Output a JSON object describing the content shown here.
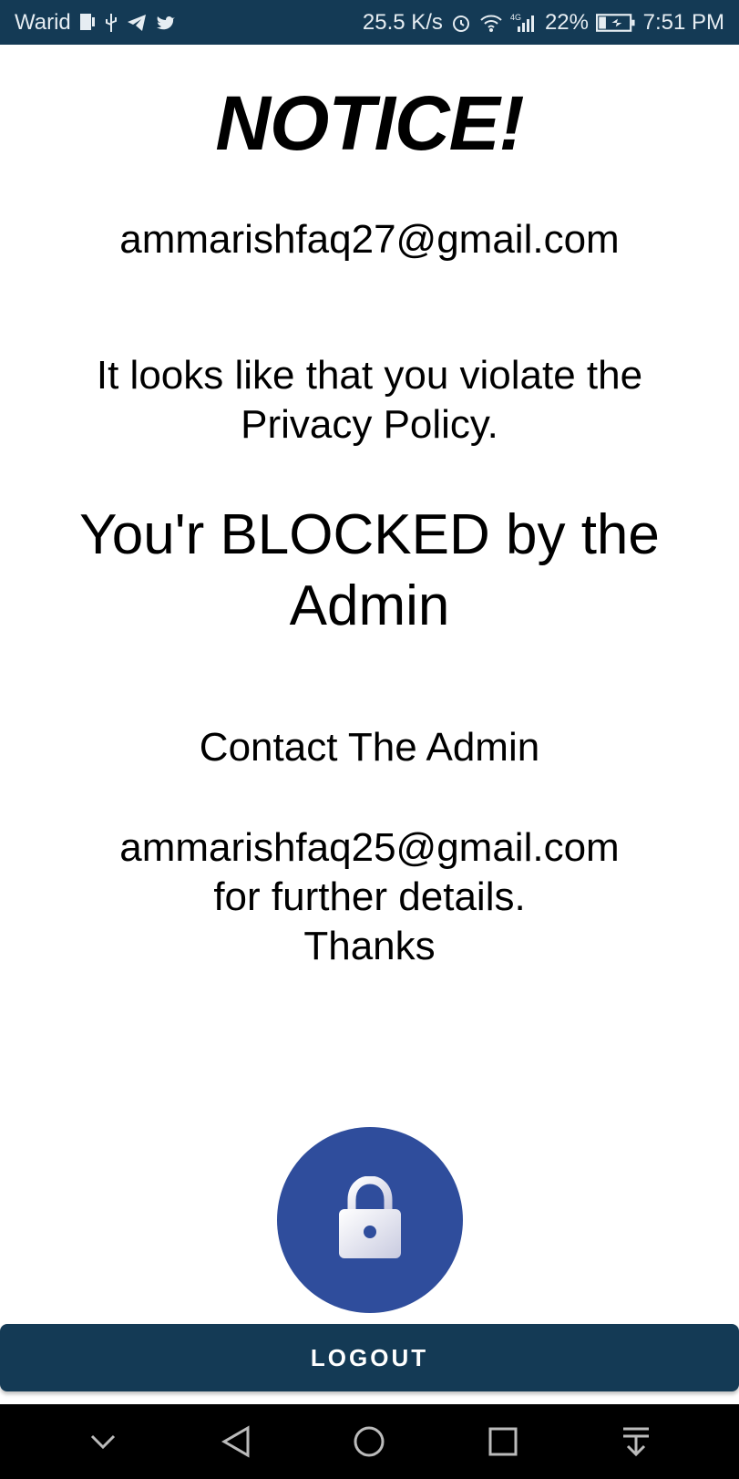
{
  "status_bar": {
    "carrier": "Warid",
    "net_speed": "25.5 K/s",
    "network_type": "4G",
    "battery": "22%",
    "time": "7:51 PM"
  },
  "notice": {
    "title": "NOTICE!",
    "user_email": "ammarishfaq27@gmail.com",
    "violation_line1": "It looks like that you violate the",
    "violation_line2": "Privacy Policy.",
    "blocked_line1": "You'r BLOCKED by the",
    "blocked_line2": "Admin",
    "contact": "Contact The Admin",
    "admin_email": "ammarishfaq25@gmail.com",
    "details": "for further details.",
    "thanks": "Thanks"
  },
  "logout_label": "LOGOUT",
  "colors": {
    "primary_dark": "#143a55",
    "lock_circle": "#2f4d9c"
  }
}
